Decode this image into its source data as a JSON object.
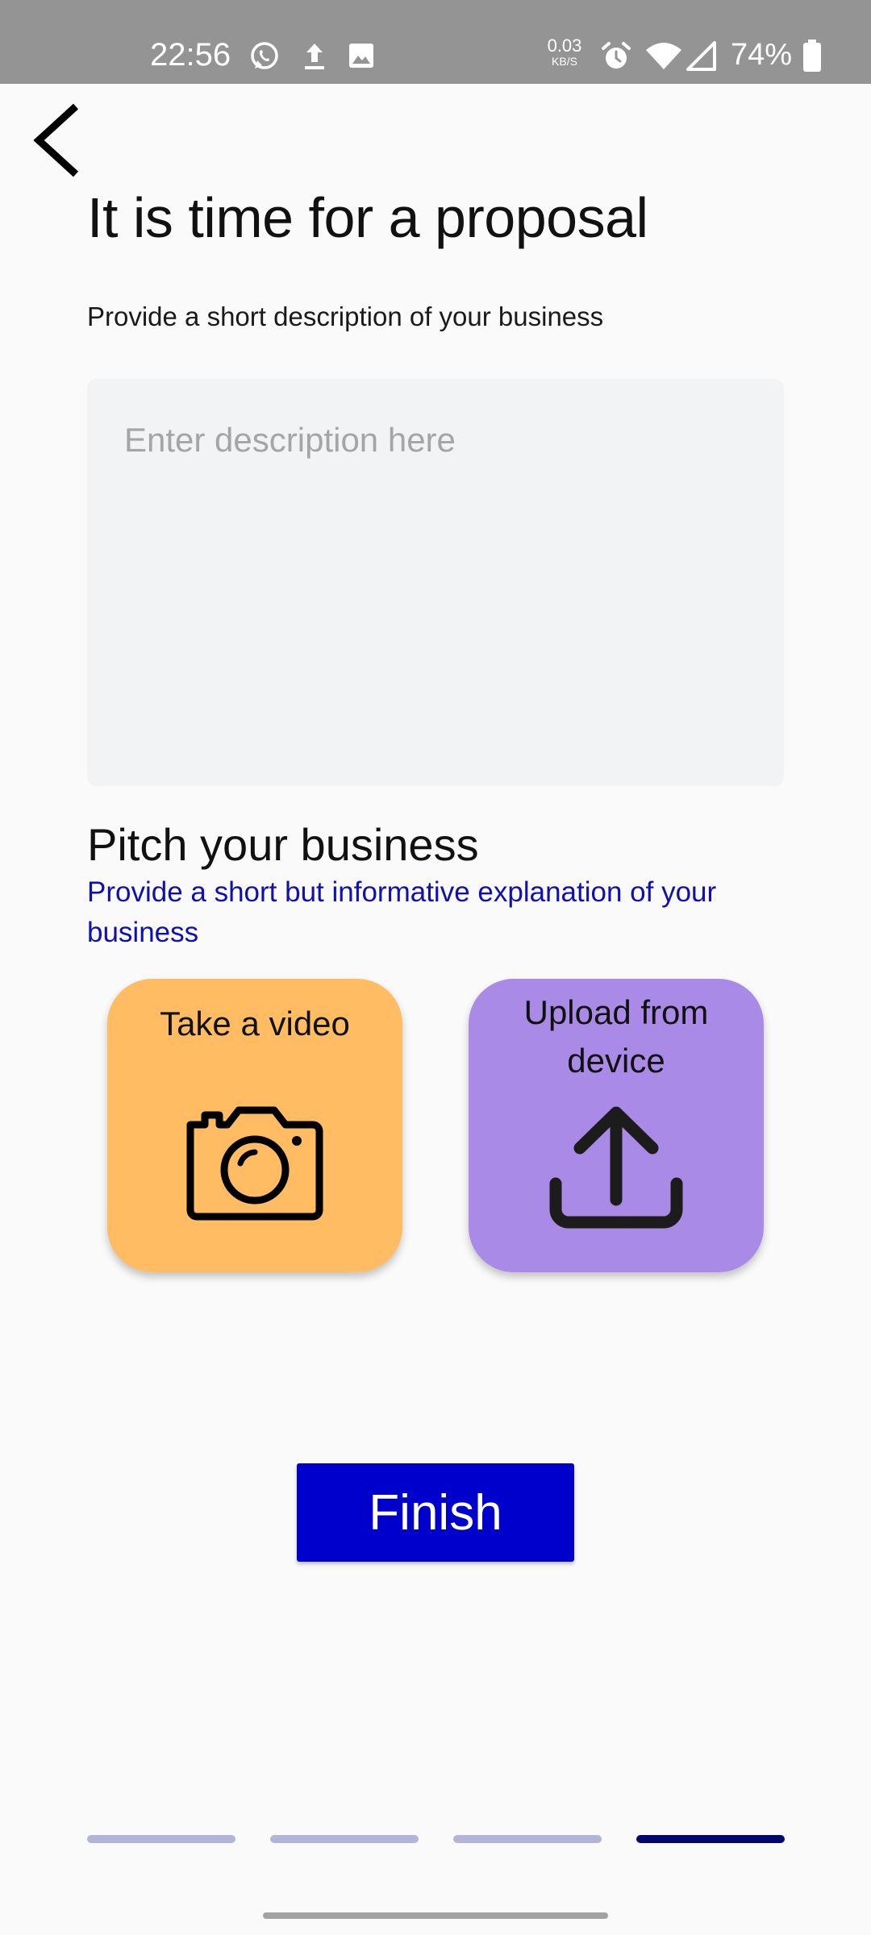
{
  "status_bar": {
    "time": "22:56",
    "net_speed_value": "0.03",
    "net_speed_unit": "KB/S",
    "battery_percent": "74%",
    "icons": [
      "whatsapp-icon",
      "upload-icon",
      "image-icon",
      "alarm-icon",
      "wifi-icon",
      "cell-signal-icon",
      "battery-icon"
    ]
  },
  "header": {
    "back_icon": "chevron-left-icon",
    "title": "It is time for a proposal"
  },
  "description": {
    "label": "Provide a short description of your business",
    "value": "",
    "placeholder": "Enter description here"
  },
  "pitch": {
    "title": "Pitch your business",
    "subtitle": "Provide a short but informative explanation of your business",
    "subtitle_color": "#1010b0",
    "cards": [
      {
        "label": "Take a video",
        "icon": "camera-icon",
        "color": "#ffbc62"
      },
      {
        "label": "Upload from device",
        "icon": "upload-icon",
        "color": "#a98ae6"
      }
    ]
  },
  "finish": {
    "label": "Finish",
    "color": "#0000cc"
  },
  "progress": {
    "total_steps": 4,
    "current_step": 4,
    "active_color": "#05056e",
    "inactive_color": "#b3b5d8"
  }
}
